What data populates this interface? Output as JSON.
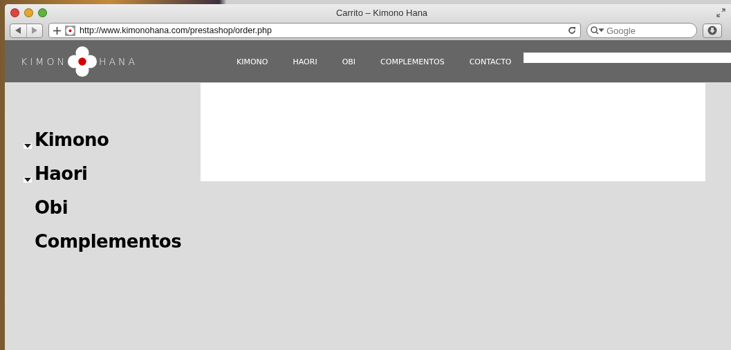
{
  "window": {
    "title": "Carrito – Kimono Hana"
  },
  "toolbar": {
    "url": "http://www.kimonohana.com/prestashop/order.php",
    "search": {
      "placeholder": "Google"
    }
  },
  "site_header": {
    "logo": {
      "left": "KIMON",
      "right": "HANA"
    },
    "nav": [
      {
        "label": "KIMONO"
      },
      {
        "label": "HAORI"
      },
      {
        "label": "OBI"
      },
      {
        "label": "COMPLEMENTOS"
      },
      {
        "label": "CONTACTO"
      }
    ]
  },
  "sidebar": {
    "items": [
      {
        "label": "Kimono",
        "has_children": true
      },
      {
        "label": "Haori",
        "has_children": true
      },
      {
        "label": "Obi",
        "has_children": false
      },
      {
        "label": "Complementos",
        "has_children": false
      }
    ]
  }
}
